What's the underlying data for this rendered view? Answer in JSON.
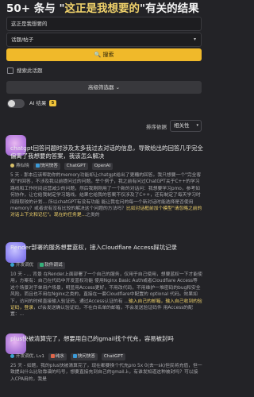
{
  "header": {
    "prefix": "50+ 条与 \"",
    "query": "这正是我想要的",
    "suffix": "\"有关的结果"
  },
  "search": {
    "value": "这正是我想要的"
  },
  "filter": {
    "category_value": "话题/帖子"
  },
  "buttons": {
    "search_icon": "🔍",
    "search_label": "搜索",
    "advanced_label": "高级筛选器",
    "advanced_caret": "⌄"
  },
  "options": {
    "search_topic_label": "搜索此话题",
    "ai_label": "AI 结果",
    "ai_badge": "5"
  },
  "sort": {
    "label": "排序依据",
    "value": "相关性"
  },
  "results": [
    {
      "title_pre": "chatgpt回答问题时涉及太多我过去对话的信息，导致给出的回答几乎完全偏离了我想要的答案，我该怎么解决",
      "meta_author": "燕似晓",
      "meta_category": "快问快答",
      "tags": [
        "ChatGPT",
        "OpenAI"
      ],
      "excerpt_1": "5 天 - 那本应该帮助你的memory功能却让chatgpt给出了更糟的回答。我只想要一个\"完全客观\"的回答，不涉及我以前提问过的问题。举个例子，我之前有问过ChatGPT关于C++的学习路线和工作时间运营减少的问题，然后我刚刚用了一个新的对话问：我想要学习pmo，参考如何协作，让它给我制定学习路线。结果它给我的答案不仅涉及了C++，还有制定了每天学习时间段取较的计划... 所以chatGPT有没有功能 能让我在问的每一个新对话时能选择是否使用memory？或者说有没有比较的解决这个问题的方法吗？",
      "excerpt_mark": "比如对话框前加个模型\"请忽略之前的对话上下文和记忆\"。现在的任务是...",
      "excerpt_2": "之类的"
    },
    {
      "title_pre": "Render部署的服务想要蓝权，接入Cloudflare Access踩坑记录",
      "meta_author": "开发调优",
      "meta_category": "软件调试",
      "tags": [],
      "excerpt_1": "10 天 - ... 背景 在Render上面部署了一个自己的服务，仅用于自己使用，想要蓝权一下才能使用，方案有：自己在代码中开发蓝权功能 使用Nginx Basic Auth或者Cloudflare Access等 这个场景对于单用户场景，明显用Access更好，不用改代码，不用维护一堆密码的bug和安全风险。而且也不用在Nginx之类的，直接在一套Cloudflare中配置的 optional 代码。效果如下，访问的时候直接输入验证码，通过Access认证的有 ...",
      "excerpt_mark": "输入自己的邮箱，输入自己收到的验证码，登录",
      "excerpt_2": "，cf会发送确认验证码，不在白名单的邮箱，不会发送验证码件 用Access的配置：..."
    },
    {
      "title_pre": "plus快被清算完了，想要用自己的gmail找个代充，容易被封吗",
      "meta_author": "开发调优, Lv1",
      "meta_category": "纯水",
      "tags": [
        "快问快答",
        "ChatGPT"
      ],
      "excerpt_1": "25 天 - 如题，我的plus快被清算完了，现在都要换个代充pro 5x 0(去一sk)但民将充值，但一致提出什么比较靠谱的吗号，想要直接充到自己的gmail上，有谁发知道这种被封吗？可以接入CPA用的，我是",
      "excerpt_mark": "",
      "excerpt_2": ""
    }
  ]
}
